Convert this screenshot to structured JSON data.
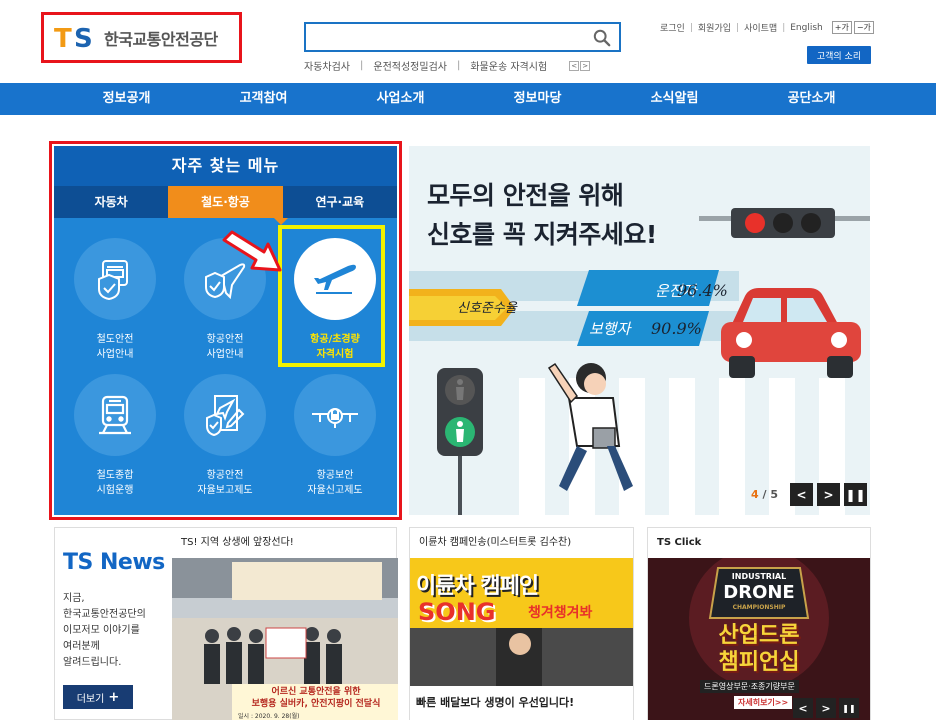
{
  "header": {
    "logo_mark": "TS",
    "logo_text": "한국교통안전공단",
    "search": {
      "value": "",
      "placeholder": ""
    },
    "keywords": [
      "자동차검사",
      "운전적성정밀검사",
      "화물운송 자격시험"
    ],
    "util_links": [
      "로그인",
      "회원가입",
      "사이트맵",
      "English"
    ],
    "font_buttons": [
      "+가",
      "−가"
    ],
    "voice_button": "고객의 소리"
  },
  "nav": [
    "정보공개",
    "고객참여",
    "사업소개",
    "정보마당",
    "소식알림",
    "공단소개"
  ],
  "favorites": {
    "title": "자주 찾는 메뉴",
    "tabs": [
      "자동차",
      "철도·항공",
      "연구·교육"
    ],
    "active_tab": 1,
    "items": [
      {
        "label": "철도안전\n사업안내",
        "icon": "train-shield-icon"
      },
      {
        "label": "항공안전\n사업안내",
        "icon": "plane-shield-icon"
      },
      {
        "label": "항공/초경량\n자격시험",
        "icon": "plane-takeoff-icon",
        "highlight": true
      },
      {
        "label": "철도종합\n시험운행",
        "icon": "train-front-icon"
      },
      {
        "label": "항공안전\n자율보고제도",
        "icon": "document-plane-icon"
      },
      {
        "label": "항공보안\n자율신고제도",
        "icon": "aviation-security-icon"
      }
    ]
  },
  "banner": {
    "headline": "모두의 안전을 위해\n신호를 꼭 지켜주세요!",
    "stat_label": "신호준수율",
    "stats": [
      {
        "label": "운전자",
        "value": "96.4%"
      },
      {
        "label": "보행자",
        "value": "90.9%"
      }
    ],
    "current": "4",
    "total": "5",
    "separator": "/",
    "colors": {
      "accent": "#f2b21c",
      "bg": "#eaf3f6"
    }
  },
  "news": {
    "brand": "TS News",
    "desc": "지금,\n한국교통안전공단의\n이모저모 이야기를\n여러분께\n알려드립니다.",
    "more": "더보기",
    "article_title": "TS! 지역 상생에 앞장선다!",
    "photo_banner": "어르신 교통안전을 위한\n보행용 실버카, 안전지팡이 전달식",
    "photo_date": "일시 : 2020. 9. 28(월)"
  },
  "video": {
    "title": "이륜차 캠페인송(미스터트롯 김수찬)",
    "thumb_line1": "이륜차 캠페인",
    "thumb_line2": "SONG",
    "thumb_right": "챙겨챙겨봐",
    "thumb_bottom": "빠른 배달보다 생명이 우선입니다!"
  },
  "click": {
    "title": "TS Click",
    "thumb_small": "INDUSTRIAL",
    "thumb_big": "DRONE",
    "thumb_sub": "CHAMPIONSHIP",
    "thumb_korean": "산업드론\n챔피언십",
    "thumb_caption": "드론영상부문·조종기량부문",
    "thumb_cta": "자세히보기>>"
  }
}
